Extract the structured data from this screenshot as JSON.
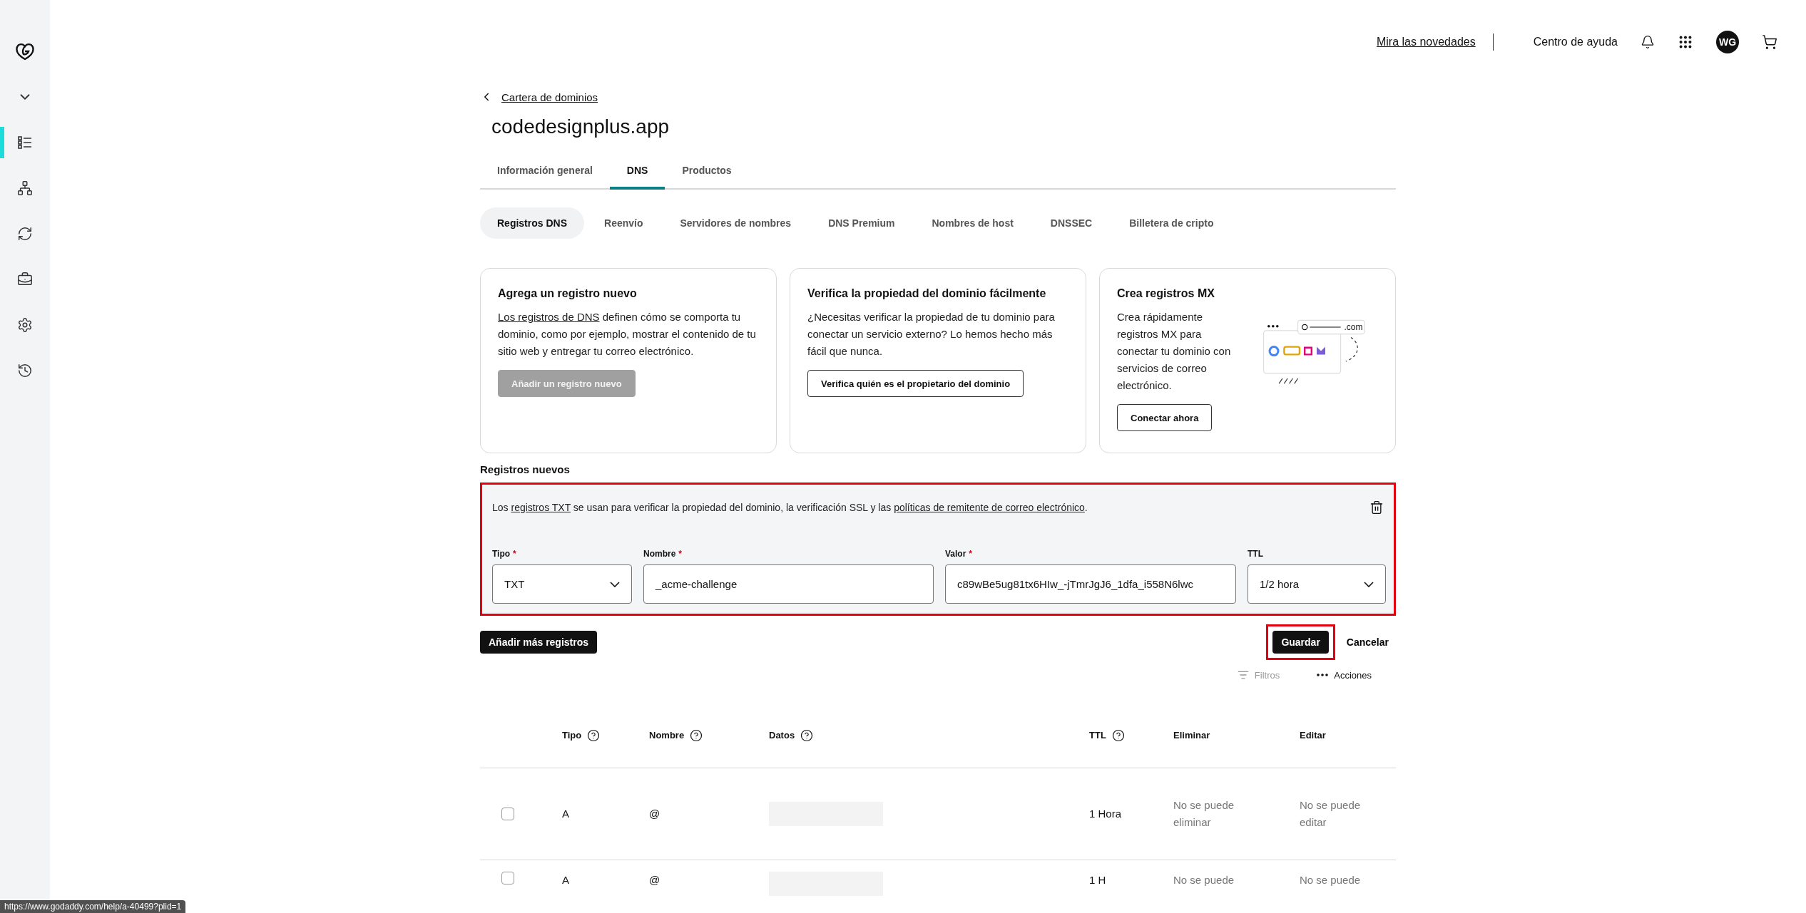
{
  "sidebar": {
    "items": [
      {
        "selected": true
      },
      {
        "selected": false
      },
      {
        "selected": false
      },
      {
        "selected": false
      },
      {
        "selected": false
      },
      {
        "selected": false
      }
    ]
  },
  "top_bar": {
    "whats_new_link": "Mira las novedades",
    "help_center": "Centro de ayuda",
    "avatar_initials": "WG"
  },
  "breadcrumb": "Cartera de dominios",
  "title": "codedesignplus.app",
  "tabs": [
    {
      "label": "Información general",
      "selected": false
    },
    {
      "label": "DNS",
      "selected": true
    },
    {
      "label": "Productos",
      "selected": false
    }
  ],
  "subtabs": [
    {
      "label": "Registros DNS",
      "selected": true
    },
    {
      "label": "Reenvío",
      "selected": false
    },
    {
      "label": "Servidores de nombres",
      "selected": false
    },
    {
      "label": "DNS Premium",
      "selected": false
    },
    {
      "label": "Nombres de host",
      "selected": false
    },
    {
      "label": "DNSSEC",
      "selected": false
    },
    {
      "label": "Billetera de cripto",
      "selected": false
    }
  ],
  "cards": [
    {
      "kind": "plain",
      "title": "Agrega un registro nuevo",
      "body": [
        {
          "text": "Los registros de DNS",
          "link": true
        },
        {
          "text": " definen cómo se comporta tu dominio, como por ejemplo, mostrar el contenido de tu sitio web y entregar tu correo electrónico."
        }
      ],
      "button": {
        "label": "Añadir un registro nuevo",
        "disabled": true
      }
    },
    {
      "kind": "plain",
      "title": "Verifica la propiedad del dominio fácilmente",
      "body": [
        {
          "text": "¿Necesitas verificar la propiedad de tu dominio para conectar un servicio externo? Lo hemos hecho más fácil que nunca."
        }
      ],
      "button": {
        "label": "Verifica quién es el propietario del dominio",
        "disabled": false
      }
    },
    {
      "kind": "illustrated",
      "title": "Crea registros MX",
      "body": [
        {
          "text": "Crea rápidamente registros MX para conectar tu dominio con servicios de correo electrónico."
        }
      ],
      "button": {
        "label": "Conectar ahora",
        "disabled": false
      },
      "illustration_label": ".com"
    }
  ],
  "new_records": {
    "heading": "Registros nuevos",
    "highlighted": true,
    "info": [
      {
        "text": "Los "
      },
      {
        "text": "registros TXT",
        "link": true
      },
      {
        "text": " se usan para verificar la propiedad del dominio, la verificación SSL y las "
      },
      {
        "text": "políticas de remitente de correo electrónico",
        "link": true
      },
      {
        "text": "."
      }
    ],
    "fields": [
      {
        "kind": "select",
        "label": "Tipo",
        "required_mark": "*",
        "value": "TXT"
      },
      {
        "kind": "input",
        "label": "Nombre",
        "required_mark": "*",
        "value": "_acme-challenge"
      },
      {
        "kind": "input",
        "label": "Valor",
        "required_mark": "*",
        "value": "c89wBe5ug81tx6HIw_-jTmrJgJ6_1dfa_i558N6lwc"
      },
      {
        "kind": "select",
        "label": "TTL",
        "value": "1/2 hora"
      }
    ]
  },
  "actions": {
    "add_more": "Añadir más registros",
    "save": {
      "label": "Guardar",
      "highlighted": true
    },
    "cancel": "Cancelar"
  },
  "table_tools": {
    "filters": "Filtros",
    "actions": "Acciones"
  },
  "table": {
    "columns": [
      {
        "label": "Tipo",
        "help": true
      },
      {
        "label": "Nombre",
        "help": true
      },
      {
        "label": "Datos",
        "help": true
      },
      {
        "label": "TTL",
        "help": true
      },
      {
        "label": "Eliminar"
      },
      {
        "label": "Editar"
      }
    ],
    "rows": [
      {
        "checked": false,
        "type": "A",
        "name": "@",
        "ttl": "1 Hora",
        "delete": "No se puede eliminar",
        "edit": "No se puede editar"
      },
      {
        "checked": false,
        "type": "A",
        "name": "@",
        "ttl": "1 H",
        "delete": "No se puede",
        "edit": "No se puede"
      }
    ]
  },
  "status_bar": {
    "url": "https://www.godaddy.com/help/a-40499?plid=1"
  }
}
